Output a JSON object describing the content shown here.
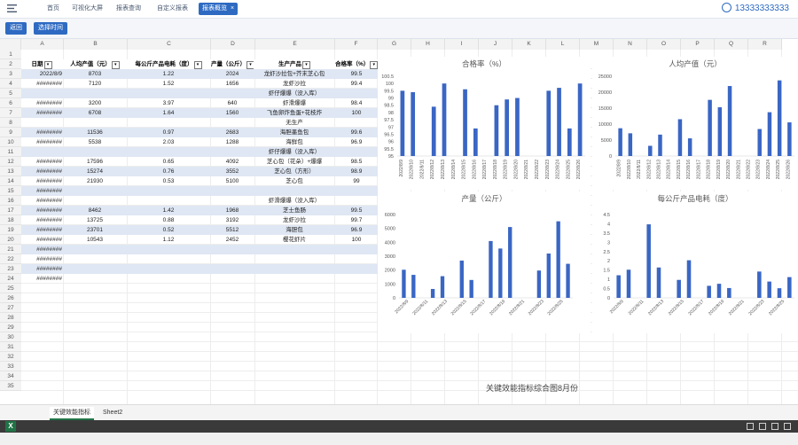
{
  "topbar": {
    "tabs": [
      {
        "label": "首页"
      },
      {
        "label": "可视化大屏"
      },
      {
        "label": "报表查询"
      },
      {
        "label": "自定义报表"
      },
      {
        "label": "报表概览",
        "active": true
      }
    ],
    "close_glyph": "×",
    "user": "13333333333"
  },
  "toolbar": {
    "back_label": "返回",
    "time_label": "选择时间"
  },
  "columns": [
    "A",
    "B",
    "C",
    "D",
    "E",
    "F",
    "G",
    "H",
    "I",
    "J",
    "K",
    "L",
    "M",
    "N",
    "O",
    "P",
    "Q",
    "R"
  ],
  "rows": [
    "2",
    "3",
    "4",
    "5",
    "6",
    "7",
    "8",
    "9",
    "10",
    "11",
    "12",
    "13",
    "14",
    "15",
    "16",
    "17",
    "18",
    "19",
    "20",
    "21",
    "22",
    "23",
    "24",
    "25",
    "26",
    "27",
    "28",
    "29",
    "30",
    "31",
    "32",
    "33",
    "34",
    "35"
  ],
  "table": {
    "headers": [
      "日期",
      "人均产值（元）",
      "每公斤产品电耗（度）",
      "产量（公斤）",
      "生产产品",
      "合格率（%）"
    ],
    "rows": [
      [
        "2022/8/9",
        "8703",
        "1.22",
        "2024",
        "龙虾沙拉包+芥末芝心包",
        "99.5"
      ],
      [
        "########",
        "7120",
        "1.52",
        "1656",
        "龙虾沙拉",
        "99.4"
      ],
      [
        "",
        "",
        "",
        "",
        "虾仔爆爆（没入库）",
        ""
      ],
      [
        "########",
        "3200",
        "3.97",
        "640",
        "虾滑爆爆",
        "98.4"
      ],
      [
        "########",
        "6708",
        "1.64",
        "1560",
        "飞鱼卵炸鱼蛋+花枝炸",
        "100"
      ],
      [
        "",
        "",
        "",
        "",
        "无生产",
        ""
      ],
      [
        "########",
        "11536",
        "0.97",
        "2683",
        "海胆墨鱼包",
        "99.6"
      ],
      [
        "########",
        "5538",
        "2.03",
        "1288",
        "海鲜包",
        "96.9"
      ],
      [
        "",
        "",
        "",
        "",
        "虾仔爆爆（没入库）",
        ""
      ],
      [
        "########",
        "17596",
        "0.65",
        "4092",
        "芝心包（花朵）+爆爆",
        "98.5"
      ],
      [
        "########",
        "15274",
        "0.76",
        "3552",
        "芝心包（方形）",
        "98.9"
      ],
      [
        "########",
        "21930",
        "0.53",
        "5100",
        "芝心包",
        "99"
      ],
      [
        "########",
        "",
        "",
        "",
        "",
        ""
      ],
      [
        "########",
        "",
        "",
        "",
        "虾滑爆爆（没入库）",
        ""
      ],
      [
        "########",
        "8462",
        "1.42",
        "1968",
        "芝士鱼肠",
        "99.5"
      ],
      [
        "########",
        "13725",
        "0.88",
        "3192",
        "龙虾沙拉",
        "99.7"
      ],
      [
        "########",
        "23701",
        "0.52",
        "5512",
        "海胆包",
        "96.9"
      ],
      [
        "########",
        "10543",
        "1.12",
        "2452",
        "樱花虾片",
        "100"
      ],
      [
        "########",
        "",
        "",
        "",
        "",
        ""
      ],
      [
        "########",
        "",
        "",
        "",
        "",
        ""
      ],
      [
        "########",
        "",
        "",
        "",
        "",
        ""
      ],
      [
        "########",
        "",
        "",
        "",
        "",
        ""
      ]
    ]
  },
  "charts": {
    "hegelv": {
      "title": "合格率（%）"
    },
    "renjun": {
      "title": "人均产值（元）"
    },
    "chanliang": {
      "title": "产量（公斤）"
    },
    "dianhao": {
      "title": "每公斤产品电耗（度）"
    },
    "combined_title": "关键效能指标综合图8月份"
  },
  "chart_data": [
    {
      "type": "bar",
      "title": "合格率（%）",
      "ylim": [
        95,
        100.5
      ],
      "yticks": [
        "100.5",
        "100",
        "99.5",
        "99",
        "98.5",
        "98",
        "97.5",
        "97",
        "96.5",
        "96",
        "95.5",
        "95"
      ],
      "categories": [
        "2022/8/9",
        "2022/8/10",
        "2022/8/11",
        "2022/8/12",
        "2022/8/13",
        "2022/8/14",
        "2022/8/15",
        "2022/8/16",
        "2022/8/17",
        "2022/8/18",
        "2022/8/19",
        "2022/8/20",
        "2022/8/21",
        "2022/8/22",
        "2022/8/23",
        "2022/8/24",
        "2022/8/25",
        "2022/8/26"
      ],
      "values": [
        99.5,
        99.4,
        null,
        98.4,
        100,
        null,
        99.6,
        96.9,
        null,
        98.5,
        98.9,
        99,
        null,
        null,
        99.5,
        99.7,
        96.9,
        100
      ]
    },
    {
      "type": "bar",
      "title": "人均产值（元）",
      "ylim": [
        0,
        25000
      ],
      "yticks": [
        "25000",
        "20000",
        "15000",
        "10000",
        "5000",
        "0"
      ],
      "categories": [
        "2022/8/9",
        "2022/8/10",
        "2022/8/11",
        "2022/8/12",
        "2022/8/13",
        "2022/8/14",
        "2022/8/15",
        "2022/8/16",
        "2022/8/17",
        "2022/8/18",
        "2022/8/19",
        "2022/8/20",
        "2022/8/21",
        "2022/8/22",
        "2022/8/23",
        "2022/8/24",
        "2022/8/25",
        "2022/8/26"
      ],
      "values": [
        8703,
        7120,
        null,
        3200,
        6708,
        null,
        11536,
        5538,
        null,
        17596,
        15274,
        21930,
        null,
        null,
        8462,
        13725,
        23701,
        10543
      ]
    },
    {
      "type": "bar",
      "title": "产量（公斤）",
      "ylim": [
        0,
        6000
      ],
      "yticks": [
        "6000",
        "5000",
        "4000",
        "3000",
        "2000",
        "1000",
        "0"
      ],
      "categories": [
        "2022/8/9",
        "2022/8/11",
        "2022/8/13",
        "2022/8/15",
        "2022/8/17",
        "2022/8/19",
        "2022/8/21",
        "2022/8/23",
        "2022/8/25"
      ],
      "values": [
        2024,
        1656,
        null,
        640,
        1560,
        null,
        2683,
        1288,
        null,
        4092,
        3552,
        5100,
        null,
        null,
        1968,
        3192,
        5512,
        2452
      ]
    },
    {
      "type": "bar",
      "title": "每公斤产品电耗（度）",
      "ylim": [
        0,
        4.5
      ],
      "yticks": [
        "4.5",
        "4",
        "3.5",
        "3",
        "2.5",
        "2",
        "1.5",
        "1",
        "0.5",
        "0"
      ],
      "categories": [
        "2022/8/9",
        "2022/8/11",
        "2022/8/13",
        "2022/8/15",
        "2022/8/17",
        "2022/8/19",
        "2022/8/21",
        "2022/8/23",
        "2022/8/25"
      ],
      "values": [
        1.22,
        1.52,
        null,
        3.97,
        1.64,
        null,
        0.97,
        2.03,
        null,
        0.65,
        0.76,
        0.53,
        null,
        null,
        1.42,
        0.88,
        0.52,
        1.12
      ]
    }
  ],
  "sheet_tabs": [
    "关键效能指标",
    "Sheet2"
  ],
  "colors": {
    "accent": "#2e6ac2",
    "bar": "#3a66c4",
    "band": "#dfe7f4",
    "excel": "#217346"
  }
}
